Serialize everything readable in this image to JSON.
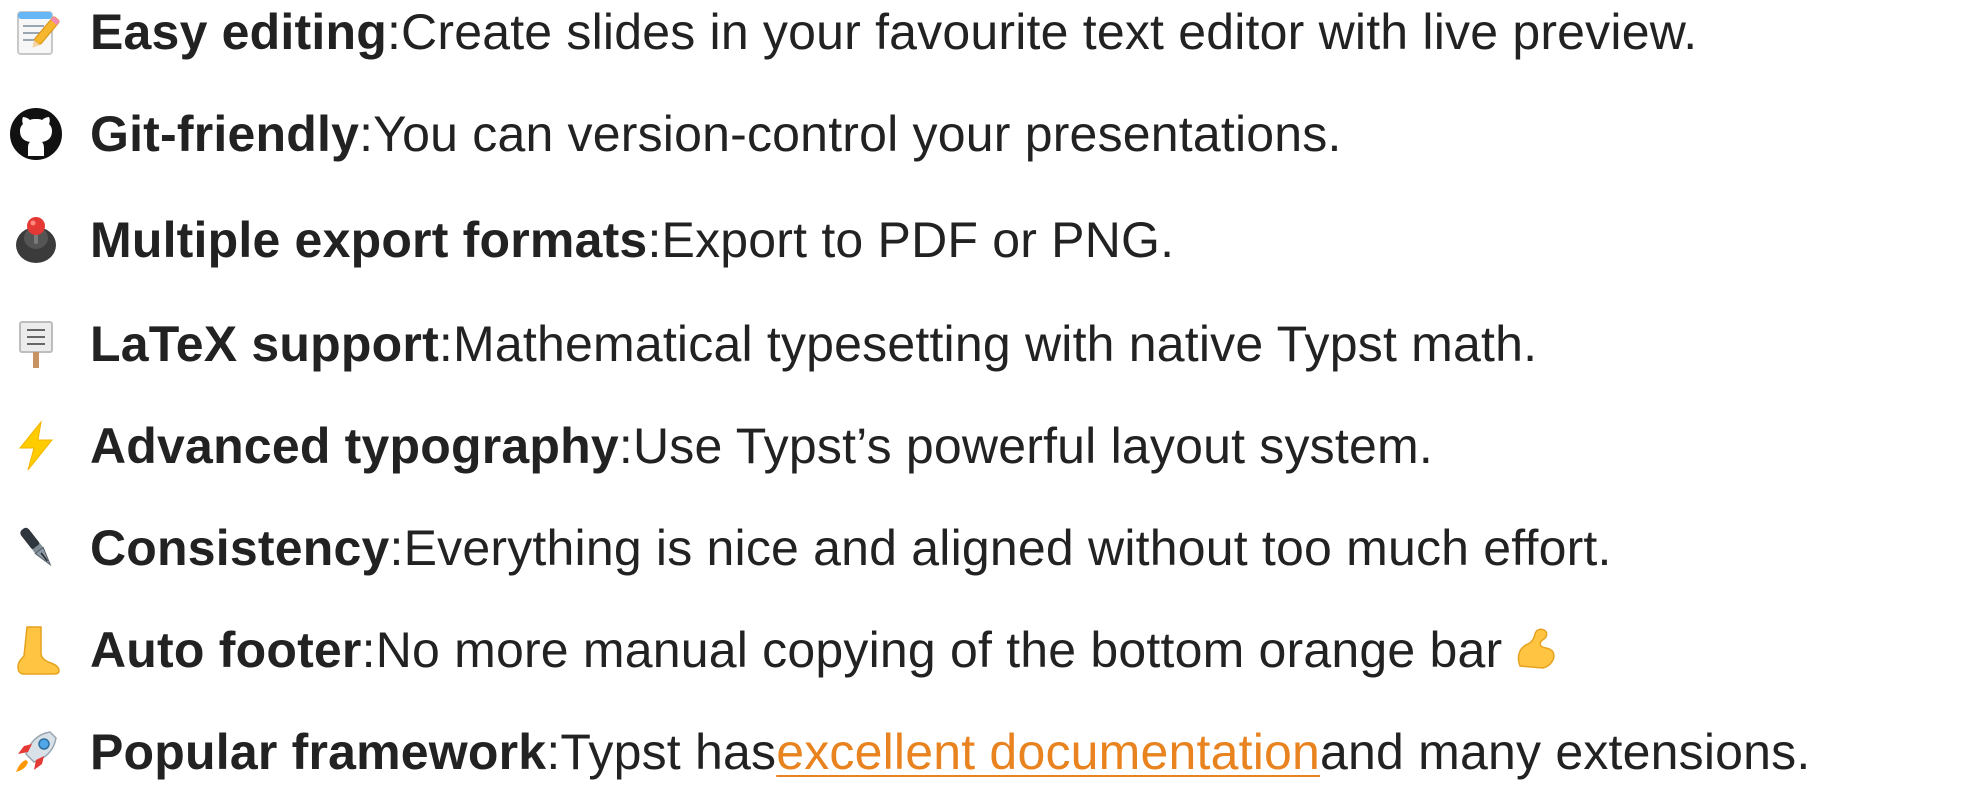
{
  "features": [
    {
      "icon": "memo-icon",
      "title": "Easy editing",
      "separator": ":",
      "text": " Create slides in your favourite text editor with live preview."
    },
    {
      "icon": "github-icon",
      "title": "Git-friendly",
      "separator": ":",
      "text": " You can version-control your presentations."
    },
    {
      "icon": "joystick-icon",
      "title": "Multiple export formats",
      "separator": ":",
      "text": " Export to PDF or PNG."
    },
    {
      "icon": "placard-icon",
      "title": "LaTeX support",
      "separator": ":",
      "text": " Mathematical typesetting with native Typst math."
    },
    {
      "icon": "high-voltage-icon",
      "title": "Advanced typography",
      "separator": ":",
      "text": " Use Typst’s powerful layout system."
    },
    {
      "icon": "fountain-pen-icon",
      "title": "Consistency",
      "separator": ":",
      "text": " Everything is nice and aligned without too much effort."
    },
    {
      "icon": "foot-icon",
      "title": "Auto footer",
      "separator": ":",
      "text": " No more manual copying of the bottom orange bar",
      "trailing_icon": "flexed-biceps-icon"
    },
    {
      "icon": "rocket-icon",
      "title": "Popular framework",
      "separator": ":",
      "text_before_link": " Typst has ",
      "link_text": "excellent documentation",
      "text_after_link": " and many extensions."
    }
  ],
  "colors": {
    "text": "#222222",
    "link": "#e8831f"
  }
}
